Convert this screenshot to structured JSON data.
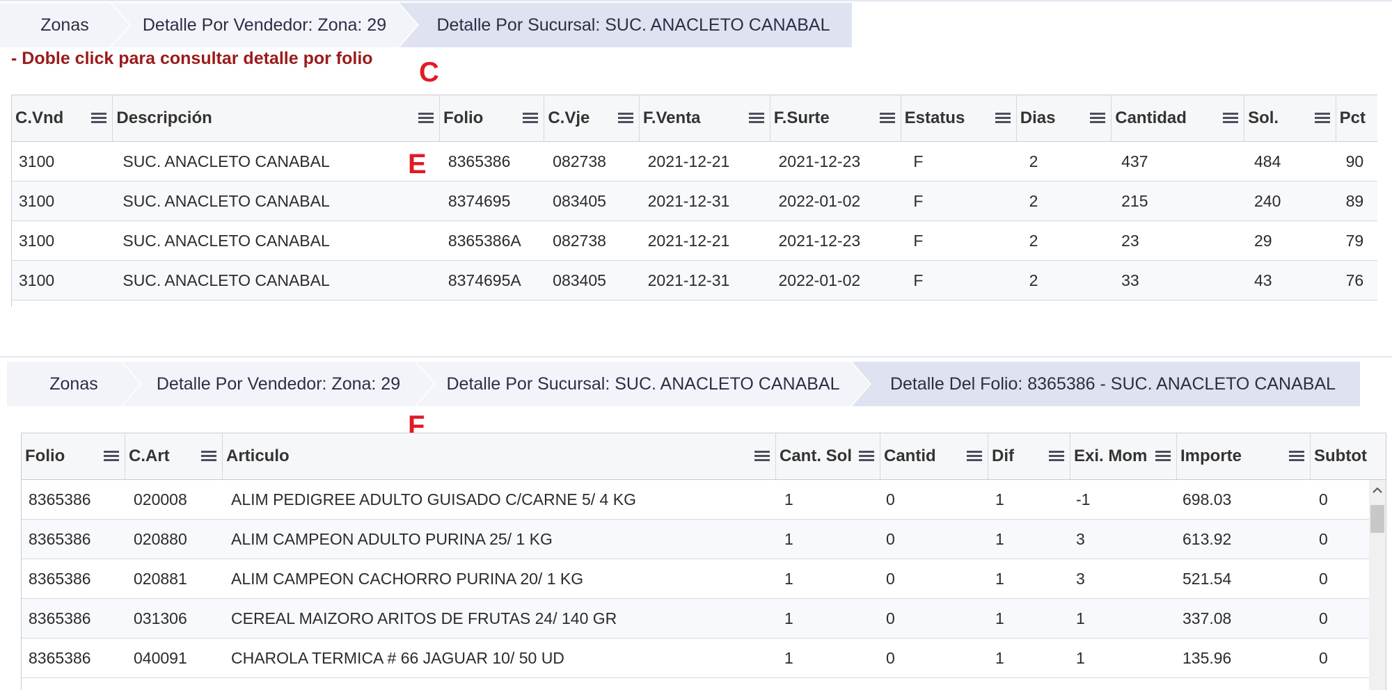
{
  "top": {
    "breadcrumb": [
      "Zonas",
      "Detalle Por Vendedor: Zona: 29",
      "Detalle Por Sucursal: SUC. ANACLETO CANABAL"
    ],
    "hint": "- Doble click para consultar detalle por folio",
    "mark_c": "C",
    "mark_e": "E",
    "columns": [
      "C.Vnd",
      "Descripción",
      "Folio",
      "C.Vje",
      "F.Venta",
      "F.Surte",
      "Estatus",
      "Dias",
      "Cantidad",
      "Sol.",
      "Pct"
    ],
    "rows": [
      [
        "3100",
        "SUC. ANACLETO CANABAL",
        "8365386",
        "082738",
        "2021-12-21",
        "2021-12-23",
        "F",
        "2",
        "437",
        "484",
        "90"
      ],
      [
        "3100",
        "SUC. ANACLETO CANABAL",
        "8374695",
        "083405",
        "2021-12-31",
        "2022-01-02",
        "F",
        "2",
        "215",
        "240",
        "89"
      ],
      [
        "3100",
        "SUC. ANACLETO CANABAL",
        "8365386A",
        "082738",
        "2021-12-21",
        "2021-12-23",
        "F",
        "2",
        "23",
        "29",
        "79"
      ],
      [
        "3100",
        "SUC. ANACLETO CANABAL",
        "8374695A",
        "083405",
        "2021-12-31",
        "2022-01-02",
        "F",
        "2",
        "33",
        "43",
        "76"
      ]
    ]
  },
  "bottom": {
    "breadcrumb": [
      "Zonas",
      "Detalle Por Vendedor: Zona: 29",
      "Detalle Por Sucursal: SUC. ANACLETO CANABAL",
      "Detalle Del Folio: 8365386 - SUC. ANACLETO CANABAL"
    ],
    "mark_f": "F",
    "columns": [
      "Folio",
      "C.Art",
      "Articulo",
      "Cant. Sol",
      "Cantid",
      "Dif",
      "Exi. Mom",
      "Importe",
      "Subtot"
    ],
    "rows": [
      [
        "8365386",
        "020008",
        "ALIM PEDIGREE ADULTO GUISADO C/CARNE 5/ 4 KG",
        "1",
        "0",
        "1",
        "-1",
        "698.03",
        "0"
      ],
      [
        "8365386",
        "020880",
        "ALIM CAMPEON ADULTO PURINA 25/ 1 KG",
        "1",
        "0",
        "1",
        "3",
        "613.92",
        "0"
      ],
      [
        "8365386",
        "020881",
        "ALIM CAMPEON CACHORRO PURINA 20/ 1 KG",
        "1",
        "0",
        "1",
        "3",
        "521.54",
        "0"
      ],
      [
        "8365386",
        "031306",
        "CEREAL MAIZORO ARITOS DE FRUTAS 24/ 140 GR",
        "1",
        "0",
        "1",
        "1",
        "337.08",
        "0"
      ],
      [
        "8365386",
        "040091",
        "CHAROLA TERMICA # 66 JAGUAR 10/ 50 UD",
        "1",
        "0",
        "1",
        "1",
        "135.96",
        "0"
      ]
    ]
  },
  "colors": {
    "hint": "#9b1b1b",
    "mark": "#e01b24",
    "crumb_light": "#f3f4fa",
    "crumb_active": "#dfe2f1"
  }
}
